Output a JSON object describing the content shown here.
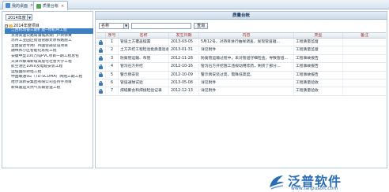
{
  "tabs": [
    {
      "label": "我的桌面",
      "active": false
    },
    {
      "label": "质量台帐",
      "active": true
    }
  ],
  "tree": {
    "year_value": "2014年度",
    "root_label": "2014年度项目",
    "items": [
      "江西机场奋三期扩建--停机坪工程",
      "京港高速公路局蒲城高架广户转佛黄",
      "苏州工业园区街道管廊太原铁路施工",
      "宜建雷达专用广州国营部谈设项目",
      "融林邦小区智能化系统工程",
      "安徽中型100万吨PVC项目一期工程总包",
      "天津市静海新城高层宅社会大学工程",
      "航空港区10KV及电缆安装工程",
      "运城国际转塔工程",
      "中国联通SG（TD-SCDMA）网络三期工程",
      "哈尔滨新安集团有限公司签州宇项目",
      "新辉嘉运天然气长输管道工程"
    ],
    "selected_index": 0
  },
  "panel": {
    "title": "质量台帐",
    "field_value": "名称",
    "search_value": "",
    "search_button": "查询"
  },
  "table": {
    "headers": [
      "序号",
      "名称",
      "发生日期",
      "内容",
      "类型",
      "备注"
    ],
    "rows": [
      {
        "no": "1",
        "name": "管道土方覆盖摆置",
        "date": "2013-03-05",
        "content": "5月12号，对持目进行抽样调查，发现管道碰...",
        "category": "工程质量监督",
        "note": ""
      },
      {
        "no": "2",
        "name": "土方开挖工程检验批质量验收记录",
        "date": "2013-01-31",
        "content": "详见附件",
        "category": "工程质量监督",
        "note": ""
      },
      {
        "no": "3",
        "name": "防腐管运输、布管",
        "date": "2012-11-28",
        "content": "防腐管运输过程中，未对管道仔细检查，导致管道...",
        "category": "工程事故报告",
        "note": ""
      },
      {
        "no": "4",
        "name": "管沟石方开挖",
        "date": "2012-10-16",
        "content": "管沟石方开挖施工违规动用炸药，剩货了部分...",
        "category": "工程事故报告",
        "note": ""
      },
      {
        "no": "5",
        "name": "警示牌安装",
        "date": "2012-10-09",
        "content": "警示牌安装过高，需降低高度。",
        "category": "工程事故报告",
        "note": ""
      },
      {
        "no": "6",
        "name": "管道通球试验",
        "date": "2013-05-08",
        "content": "详见附件",
        "category": "工程质量验收",
        "note": ""
      },
      {
        "no": "7",
        "name": "焊缝聚会和焊接检验记录",
        "date": "2012-12-13",
        "content": "详见附件",
        "category": "工程质量验收",
        "note": ""
      }
    ]
  },
  "watermark": {
    "brand": "泛普软件",
    "url": "www.fanpusoft.com"
  },
  "colors": {
    "tab_border": "#9fb6cc",
    "tree_selected": "#3c7fc3",
    "header_text": "#a03030",
    "brand_blue": "#2b6db3"
  }
}
